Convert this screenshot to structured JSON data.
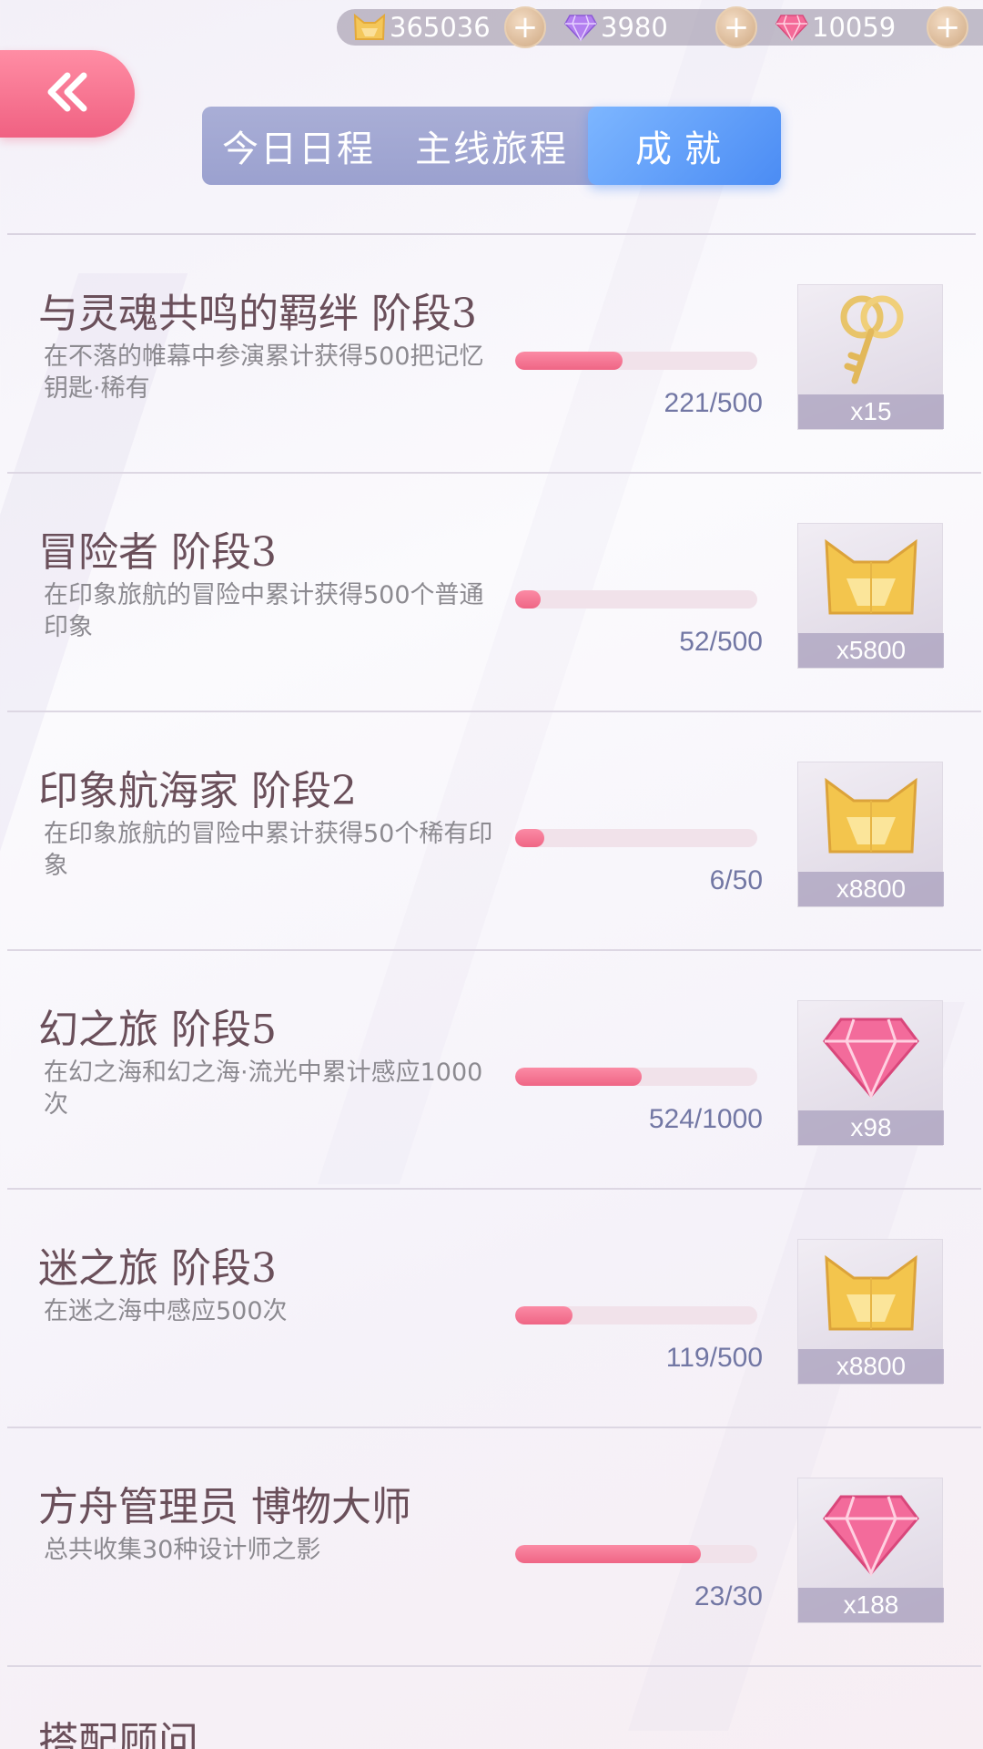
{
  "currencies": [
    {
      "icon": "cat-coin-icon",
      "value": "365036"
    },
    {
      "icon": "purple-diamond-icon",
      "value": "3980"
    },
    {
      "icon": "pink-diamond-icon",
      "value": "10059"
    }
  ],
  "plus_label": "+",
  "tabs": [
    {
      "label": "今日日程",
      "active": false
    },
    {
      "label": "主线旅程",
      "active": false
    },
    {
      "label": "成就",
      "active": true
    }
  ],
  "achievements": [
    {
      "title": "与灵魂共鸣的羁绊 阶段3",
      "desc": "在不落的帷幕中参演累计获得500把记忆钥匙·稀有",
      "progress": "221/500",
      "fraction": 0.442,
      "reward_icon": "key-icon",
      "reward_qty": "x15"
    },
    {
      "title": "冒险者 阶段3",
      "desc": "在印象旅航的冒险中累计获得500个普通印象",
      "progress": "52/500",
      "fraction": 0.104,
      "reward_icon": "cat-coin-icon",
      "reward_qty": "x5800"
    },
    {
      "title": "印象航海家 阶段2",
      "desc": "在印象旅航的冒险中累计获得50个稀有印象",
      "progress": "6/50",
      "fraction": 0.12,
      "reward_icon": "cat-coin-icon",
      "reward_qty": "x8800"
    },
    {
      "title": "幻之旅 阶段5",
      "desc": "在幻之海和幻之海·流光中累计感应1000次",
      "progress": "524/1000",
      "fraction": 0.524,
      "reward_icon": "pink-diamond-icon",
      "reward_qty": "x98"
    },
    {
      "title": "迷之旅 阶段3",
      "desc": "在迷之海中感应500次",
      "progress": "119/500",
      "fraction": 0.238,
      "reward_icon": "cat-coin-icon",
      "reward_qty": "x8800"
    },
    {
      "title": "方舟管理员 博物大师",
      "desc": "总共收集30种设计师之影",
      "progress": "23/30",
      "fraction": 0.767,
      "reward_icon": "pink-diamond-icon",
      "reward_qty": "x188"
    }
  ],
  "partial_title": "搭配顾问"
}
